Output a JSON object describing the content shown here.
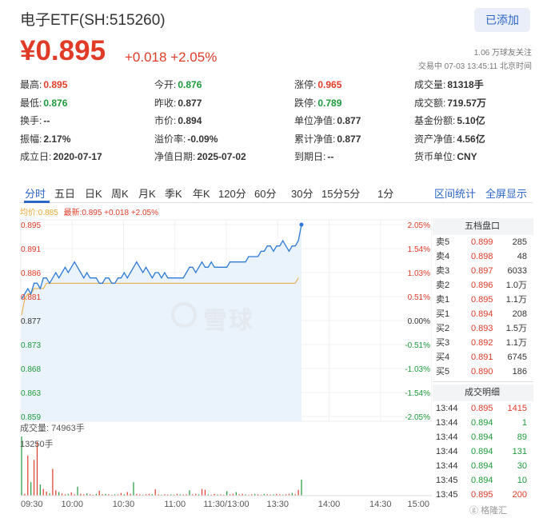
{
  "header": {
    "title": "电子ETF(SH:515260)",
    "follow_label": "已添加",
    "price": "¥0.895",
    "change": "+0.018 +2.05%",
    "followers": "1.06 万球友关注",
    "status": "交易中 07-03 13:45:11 北京时间"
  },
  "quote": [
    [
      {
        "label": "最高:",
        "value": "0.895",
        "color": "red"
      },
      {
        "label": "今开:",
        "value": "0.876",
        "color": "green"
      },
      {
        "label": "涨停:",
        "value": "0.965",
        "color": "red"
      },
      {
        "label": "成交量:",
        "value": "81318手",
        "color": ""
      }
    ],
    [
      {
        "label": "最低:",
        "value": "0.876",
        "color": "green"
      },
      {
        "label": "昨收:",
        "value": "0.877",
        "color": ""
      },
      {
        "label": "跌停:",
        "value": "0.789",
        "color": "green"
      },
      {
        "label": "成交额:",
        "value": "719.57万",
        "color": ""
      }
    ],
    [
      {
        "label": "换手:",
        "value": "--",
        "color": ""
      },
      {
        "label": "市价:",
        "value": "0.894",
        "color": ""
      },
      {
        "label": "单位净值:",
        "value": "0.877",
        "color": ""
      },
      {
        "label": "基金份额:",
        "value": "5.10亿",
        "color": ""
      }
    ],
    [
      {
        "label": "振幅:",
        "value": "2.17%",
        "color": ""
      },
      {
        "label": "溢价率:",
        "value": "-0.09%",
        "color": ""
      },
      {
        "label": "累计净值:",
        "value": "0.877",
        "color": ""
      },
      {
        "label": "资产净值:",
        "value": "4.56亿",
        "color": ""
      }
    ],
    [
      {
        "label": "成立日:",
        "value": "2020-07-17",
        "color": ""
      },
      {
        "label": "净值日期:",
        "value": "2025-07-02",
        "color": ""
      },
      {
        "label": "到期日:",
        "value": "--",
        "color": ""
      },
      {
        "label": "货币单位:",
        "value": "CNY",
        "color": ""
      }
    ]
  ],
  "tabs": [
    "分时",
    "五日",
    "日K",
    "周K",
    "月K",
    "季K",
    "年K",
    "120分",
    "60分",
    "30分",
    "15分",
    "5分",
    "1分"
  ],
  "tabs_right": [
    "区间统计",
    "全屏显示"
  ],
  "legend": {
    "avg": "均价:0.885",
    "latest": "最新:0.895 +0.018 +2.05%"
  },
  "watermark": "雪球",
  "order_book": {
    "title": "五档盘口",
    "sell": [
      {
        "label": "卖5",
        "price": "0.899",
        "vol": "285"
      },
      {
        "label": "卖4",
        "price": "0.898",
        "vol": "48"
      },
      {
        "label": "卖3",
        "price": "0.897",
        "vol": "6033"
      },
      {
        "label": "卖2",
        "price": "0.896",
        "vol": "1.0万"
      },
      {
        "label": "卖1",
        "price": "0.895",
        "vol": "1.1万"
      }
    ],
    "buy": [
      {
        "label": "买1",
        "price": "0.894",
        "vol": "208"
      },
      {
        "label": "买2",
        "price": "0.893",
        "vol": "1.5万"
      },
      {
        "label": "买3",
        "price": "0.892",
        "vol": "1.1万"
      },
      {
        "label": "买4",
        "price": "0.891",
        "vol": "6745"
      },
      {
        "label": "买5",
        "price": "0.890",
        "vol": "186"
      }
    ]
  },
  "trades": {
    "title": "成交明细",
    "rows": [
      {
        "time": "13:44",
        "price": "0.895",
        "vol": "1415",
        "color": "red"
      },
      {
        "time": "13:44",
        "price": "0.894",
        "vol": "1",
        "color": "green"
      },
      {
        "time": "13:44",
        "price": "0.894",
        "vol": "89",
        "color": "green"
      },
      {
        "time": "13:44",
        "price": "0.894",
        "vol": "131",
        "color": "green"
      },
      {
        "time": "13:44",
        "price": "0.894",
        "vol": "30",
        "color": "green"
      },
      {
        "time": "13:45",
        "price": "0.894",
        "vol": "10",
        "color": "green"
      },
      {
        "time": "13:45",
        "price": "0.895",
        "vol": "200",
        "color": "red"
      }
    ]
  },
  "volume": {
    "label": "成交量: 74963手",
    "max": "13250手"
  },
  "corner_text": "格隆汇",
  "chart_data": {
    "type": "line",
    "y_price_ticks": [
      "0.895",
      "0.891",
      "0.886",
      "0.881",
      "0.877",
      "0.873",
      "0.868",
      "0.863",
      "0.859"
    ],
    "y_pct_ticks": [
      "2.05%",
      "1.54%",
      "1.03%",
      "0.51%",
      "0.00%",
      "-0.51%",
      "-1.03%",
      "-1.54%",
      "-2.05%"
    ],
    "x_ticks": [
      "09:30",
      "10:00",
      "10:30",
      "11:00",
      "11:30/13:00",
      "13:30",
      "14:00",
      "14:30",
      "15:00"
    ],
    "ylim": [
      0.859,
      0.895
    ],
    "prev_close": 0.877,
    "series": [
      {
        "name": "最新",
        "values": [
          0.881,
          0.882,
          0.883,
          0.882,
          0.884,
          0.884,
          0.883,
          0.885,
          0.885,
          0.884,
          0.885,
          0.886,
          0.885,
          0.886,
          0.887,
          0.886,
          0.887,
          0.888,
          0.887,
          0.886,
          0.885,
          0.886,
          0.885,
          0.885,
          0.885,
          0.884,
          0.884,
          0.885,
          0.885,
          0.884,
          0.884,
          0.885,
          0.885,
          0.886,
          0.885,
          0.886,
          0.887,
          0.888,
          0.887,
          0.886,
          0.887,
          0.886,
          0.885,
          0.886,
          0.886,
          0.885,
          0.886,
          0.885,
          0.885,
          0.885,
          0.885,
          0.885,
          0.885,
          0.886,
          0.887,
          0.887,
          0.886,
          0.887,
          0.888,
          0.887,
          0.887,
          0.888,
          0.887,
          0.887,
          0.887,
          0.887,
          0.887,
          0.888,
          0.888,
          0.888,
          0.888,
          0.888,
          0.888,
          0.889,
          0.889,
          0.889,
          0.889,
          0.89,
          0.89,
          0.891,
          0.891,
          0.89,
          0.891,
          0.891,
          0.892,
          0.891,
          0.89,
          0.891,
          0.891,
          0.892,
          0.895
        ]
      },
      {
        "name": "均价",
        "values": [
          0.878,
          0.881,
          0.882,
          0.882,
          0.883,
          0.883,
          0.883,
          0.883,
          0.884,
          0.884,
          0.884,
          0.884,
          0.884,
          0.884,
          0.884,
          0.884,
          0.884,
          0.884,
          0.884,
          0.884,
          0.884,
          0.884,
          0.884,
          0.884,
          0.884,
          0.884,
          0.884,
          0.884,
          0.884,
          0.884,
          0.884,
          0.884,
          0.884,
          0.884,
          0.884,
          0.884,
          0.884,
          0.884,
          0.884,
          0.884,
          0.884,
          0.884,
          0.884,
          0.884,
          0.884,
          0.884,
          0.884,
          0.884,
          0.884,
          0.884,
          0.884,
          0.884,
          0.884,
          0.884,
          0.884,
          0.884,
          0.884,
          0.884,
          0.884,
          0.884,
          0.884,
          0.884,
          0.884,
          0.884,
          0.884,
          0.884,
          0.884,
          0.884,
          0.884,
          0.884,
          0.884,
          0.884,
          0.884,
          0.884,
          0.884,
          0.884,
          0.884,
          0.884,
          0.884,
          0.884,
          0.884,
          0.884,
          0.884,
          0.884,
          0.884,
          0.884,
          0.884,
          0.884,
          0.884,
          0.885
        ]
      }
    ],
    "volume": [
      13250,
      400,
      9000,
      3000,
      8000,
      12000,
      2500,
      1500,
      900,
      500,
      6000,
      1200,
      800,
      500,
      300,
      400,
      700,
      300,
      2000,
      400,
      300,
      500,
      300,
      200,
      400,
      1100,
      300,
      400,
      300,
      200,
      300,
      250,
      600,
      300,
      800,
      400,
      3000,
      400,
      300,
      200,
      300,
      400,
      300,
      1400,
      300,
      200,
      300,
      250,
      300,
      200,
      400,
      300,
      250,
      300,
      1200,
      300,
      400,
      300,
      1500,
      1300,
      300,
      200,
      400,
      250,
      300,
      200,
      1000,
      300,
      400,
      800,
      300,
      400,
      300,
      200,
      300,
      400,
      300,
      200,
      400,
      300,
      250,
      300,
      400,
      300,
      200,
      300,
      400,
      600,
      300,
      1300,
      3600
    ]
  }
}
